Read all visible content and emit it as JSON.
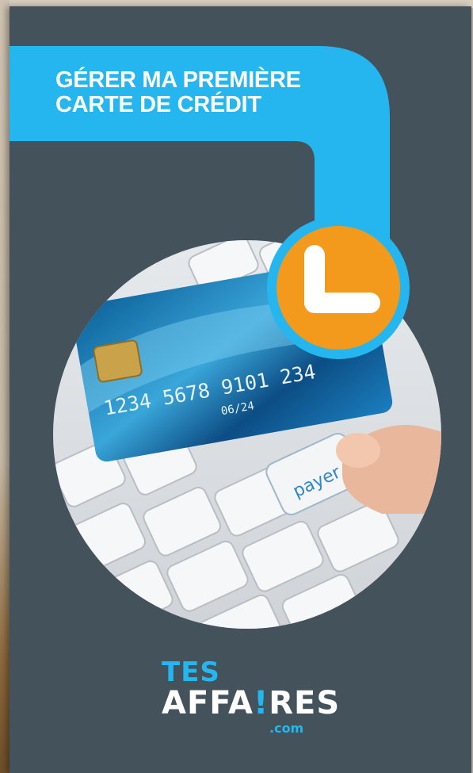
{
  "cover": {
    "title_line1": "GÉRER MA PREMIÈRE",
    "title_line2": "CARTE DE CRÉDIT",
    "card_number": "1234 5678 9101 234",
    "card_expiry": "06/24",
    "key_label": "payer",
    "logo": {
      "line1": "TES",
      "line2_start": "AFFA",
      "line2_bang": "!",
      "line2_end": "RES",
      "com": ".com"
    }
  },
  "colors": {
    "background": "#43525b",
    "accent_blue": "#26b6ef",
    "accent_orange": "#f39a1d",
    "white": "#ffffff"
  }
}
